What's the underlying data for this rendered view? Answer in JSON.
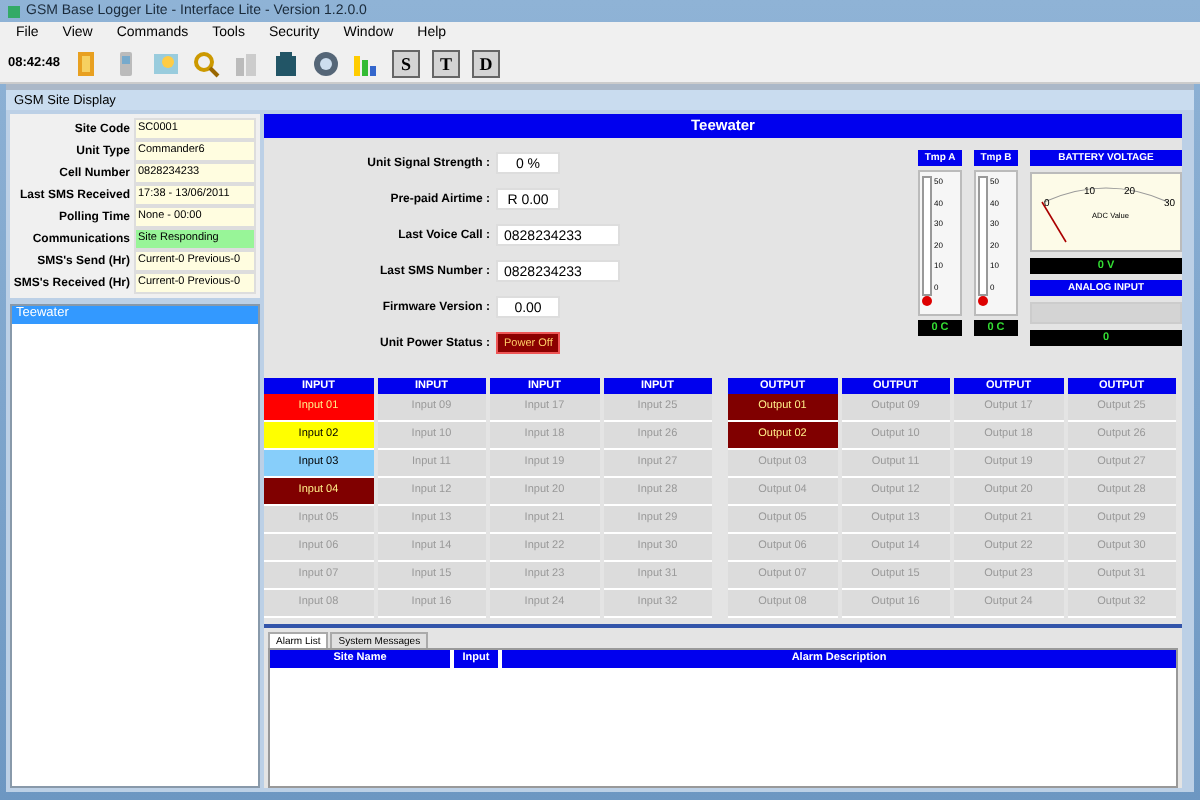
{
  "window": {
    "title": "GSM Base Logger Lite - Interface Lite - Version 1.2.0.0"
  },
  "menu": [
    "File",
    "View",
    "Commands",
    "Tools",
    "Security",
    "Window",
    "Help"
  ],
  "toolbar": {
    "time": "08:42:48",
    "letter_buttons": [
      "S",
      "T",
      "D"
    ]
  },
  "child_window": {
    "title": "GSM Site Display"
  },
  "site_info": [
    {
      "label": "Site Code",
      "value": "SC0001",
      "kind": "plain"
    },
    {
      "label": "Unit Type",
      "value": "Commander6",
      "kind": "plain"
    },
    {
      "label": "Cell Number",
      "value": "0828234233",
      "kind": "plain"
    },
    {
      "label": "Last SMS Received",
      "value": "17:38 - 13/06/2011",
      "kind": "plain"
    },
    {
      "label": "Polling Time",
      "value": "None - 00:00",
      "kind": "plain"
    },
    {
      "label": "Communications",
      "value": "Site Responding",
      "kind": "status"
    },
    {
      "label": "SMS's Send (Hr)",
      "value": "Current-0 Previous-0",
      "kind": "plain"
    },
    {
      "label": "SMS's Received (Hr)",
      "value": "Current-0 Previous-0",
      "kind": "plain"
    }
  ],
  "sites": [
    {
      "label": "Teewater",
      "selected": true
    }
  ],
  "site_title": "Teewater",
  "fields": [
    {
      "label": "Unit Signal Strength :",
      "value": "0 %",
      "kind": "short"
    },
    {
      "label": "Pre-paid Airtime :",
      "value": "R 0.00",
      "kind": "short"
    },
    {
      "label": "Last Voice Call :",
      "value": "0828234233",
      "kind": "long"
    },
    {
      "label": "Last SMS Number :",
      "value": "0828234233",
      "kind": "long"
    },
    {
      "label": "Firmware Version :",
      "value": "0.00",
      "kind": "short"
    },
    {
      "label": "Unit Power Status :",
      "value": "Power Off",
      "kind": "status"
    }
  ],
  "thermometers": [
    {
      "title": "Tmp A",
      "scale": [
        "50",
        "40",
        "30",
        "20",
        "10",
        "0"
      ],
      "reading": "0 C"
    },
    {
      "title": "Tmp B",
      "scale": [
        "50",
        "40",
        "30",
        "20",
        "10",
        "0"
      ],
      "reading": "0 C"
    }
  ],
  "battery": {
    "title": "BATTERY VOLTAGE",
    "scale": [
      "0",
      "10",
      "20",
      "30"
    ],
    "caption": "ADC Value",
    "reading": "0 V"
  },
  "analog": {
    "title": "ANALOG INPUT",
    "reading": "0"
  },
  "io_columns": [
    {
      "header": "INPUT",
      "cells": [
        {
          "label": "Input 01",
          "active": true,
          "color": "#ff0000"
        },
        {
          "label": "Input 02",
          "active": true,
          "color": "#ffff00"
        },
        {
          "label": "Input 03",
          "active": true,
          "color": "#87cefa"
        },
        {
          "label": "Input 04",
          "active": true,
          "color": "#800000"
        },
        {
          "label": "Input 05",
          "active": false
        },
        {
          "label": "Input 06",
          "active": false
        },
        {
          "label": "Input 07",
          "active": false
        },
        {
          "label": "Input 08",
          "active": false
        }
      ]
    },
    {
      "header": "INPUT",
      "cells": [
        {
          "label": "Input 09",
          "active": false
        },
        {
          "label": "Input 10",
          "active": false
        },
        {
          "label": "Input 11",
          "active": false
        },
        {
          "label": "Input 12",
          "active": false
        },
        {
          "label": "Input 13",
          "active": false
        },
        {
          "label": "Input 14",
          "active": false
        },
        {
          "label": "Input 15",
          "active": false
        },
        {
          "label": "Input 16",
          "active": false
        }
      ]
    },
    {
      "header": "INPUT",
      "cells": [
        {
          "label": "Input 17",
          "active": false
        },
        {
          "label": "Input 18",
          "active": false
        },
        {
          "label": "Input 19",
          "active": false
        },
        {
          "label": "Input 20",
          "active": false
        },
        {
          "label": "Input 21",
          "active": false
        },
        {
          "label": "Input 22",
          "active": false
        },
        {
          "label": "Input 23",
          "active": false
        },
        {
          "label": "Input 24",
          "active": false
        }
      ]
    },
    {
      "header": "INPUT",
      "cells": [
        {
          "label": "Input 25",
          "active": false
        },
        {
          "label": "Input 26",
          "active": false
        },
        {
          "label": "Input 27",
          "active": false
        },
        {
          "label": "Input 28",
          "active": false
        },
        {
          "label": "Input 29",
          "active": false
        },
        {
          "label": "Input 30",
          "active": false
        },
        {
          "label": "Input 31",
          "active": false
        },
        {
          "label": "Input 32",
          "active": false
        }
      ]
    },
    {
      "header": "OUTPUT",
      "cells": [
        {
          "label": "Output 01",
          "active": true,
          "color": "#800000"
        },
        {
          "label": "Output 02",
          "active": true,
          "color": "#800000"
        },
        {
          "label": "Output 03",
          "active": false
        },
        {
          "label": "Output 04",
          "active": false
        },
        {
          "label": "Output 05",
          "active": false
        },
        {
          "label": "Output 06",
          "active": false
        },
        {
          "label": "Output 07",
          "active": false
        },
        {
          "label": "Output 08",
          "active": false
        }
      ]
    },
    {
      "header": "OUTPUT",
      "cells": [
        {
          "label": "Output 09",
          "active": false
        },
        {
          "label": "Output 10",
          "active": false
        },
        {
          "label": "Output 11",
          "active": false
        },
        {
          "label": "Output 12",
          "active": false
        },
        {
          "label": "Output 13",
          "active": false
        },
        {
          "label": "Output 14",
          "active": false
        },
        {
          "label": "Output 15",
          "active": false
        },
        {
          "label": "Output 16",
          "active": false
        }
      ]
    },
    {
      "header": "OUTPUT",
      "cells": [
        {
          "label": "Output 17",
          "active": false
        },
        {
          "label": "Output 18",
          "active": false
        },
        {
          "label": "Output 19",
          "active": false
        },
        {
          "label": "Output 20",
          "active": false
        },
        {
          "label": "Output 21",
          "active": false
        },
        {
          "label": "Output 22",
          "active": false
        },
        {
          "label": "Output 23",
          "active": false
        },
        {
          "label": "Output 24",
          "active": false
        }
      ]
    },
    {
      "header": "OUTPUT",
      "cells": [
        {
          "label": "Output 25",
          "active": false
        },
        {
          "label": "Output 26",
          "active": false
        },
        {
          "label": "Output 27",
          "active": false
        },
        {
          "label": "Output 28",
          "active": false
        },
        {
          "label": "Output 29",
          "active": false
        },
        {
          "label": "Output 30",
          "active": false
        },
        {
          "label": "Output 31",
          "active": false
        },
        {
          "label": "Output 32",
          "active": false
        }
      ]
    }
  ],
  "alarm_tabs": [
    {
      "label": "Alarm List",
      "selected": true
    },
    {
      "label": "System Messages",
      "selected": false
    }
  ],
  "alarm_table": {
    "columns": [
      "Site Name",
      "Input",
      "Alarm Description"
    ]
  }
}
